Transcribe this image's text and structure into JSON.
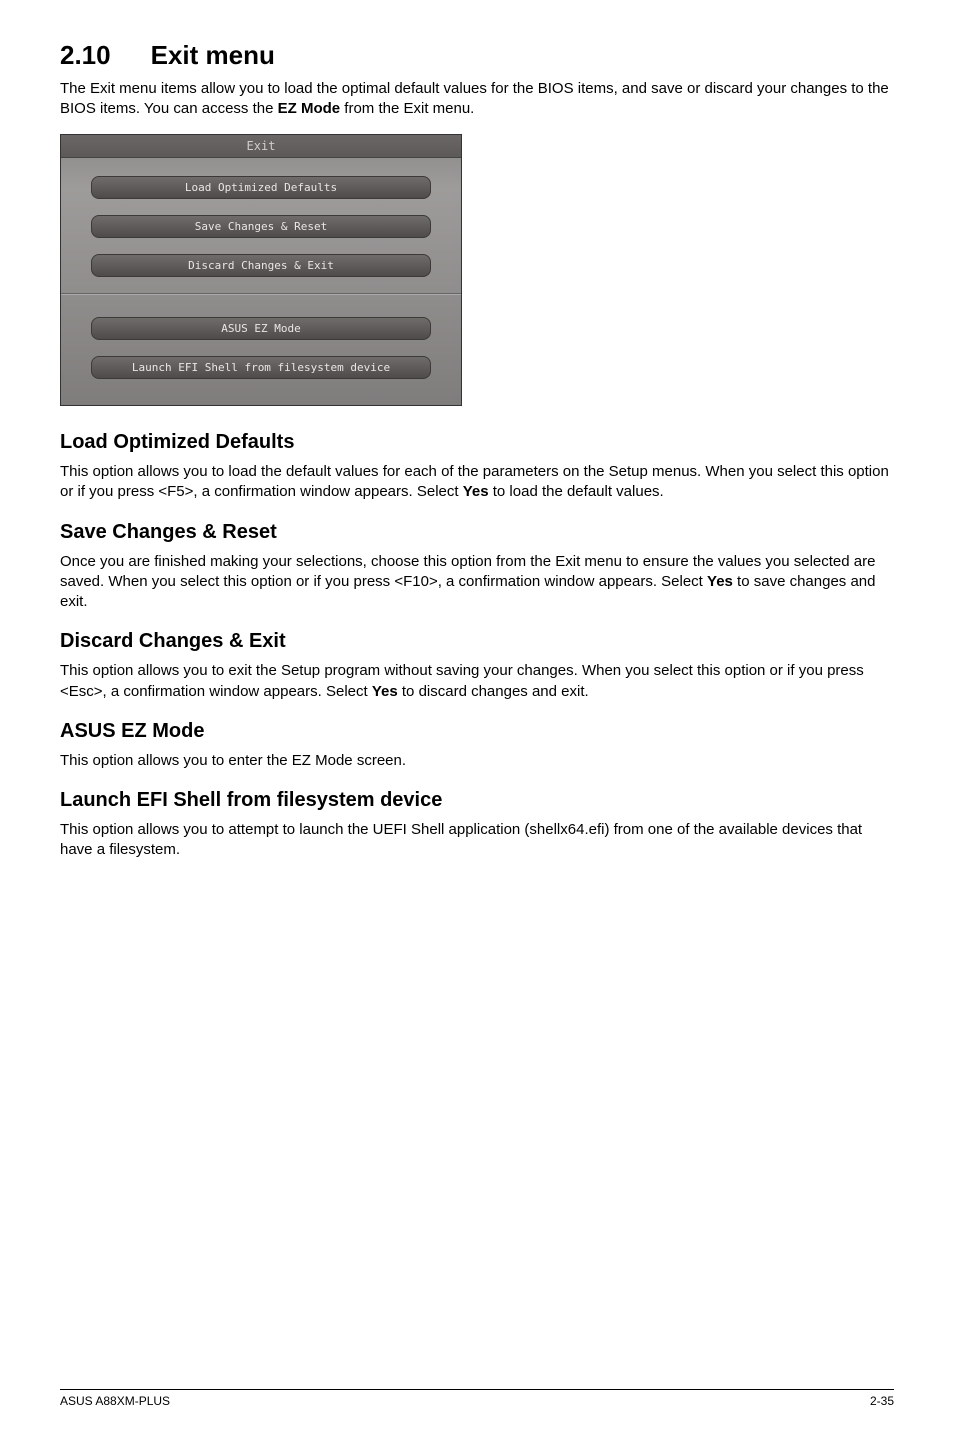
{
  "section": {
    "number": "2.10",
    "title": "Exit menu",
    "intro_pre": "The Exit menu items allow you to load the optimal default values for the BIOS items, and save or discard your changes to the BIOS items. You can access the ",
    "intro_bold": "EZ Mode",
    "intro_post": " from the Exit menu."
  },
  "bios": {
    "title": "Exit",
    "buttons_top": [
      "Load Optimized Defaults",
      "Save Changes & Reset",
      "Discard Changes & Exit"
    ],
    "buttons_bottom": [
      "ASUS EZ Mode",
      "Launch EFI Shell from filesystem device"
    ]
  },
  "subsections": {
    "load_defaults": {
      "heading": "Load Optimized Defaults",
      "p1": "This option allows you to load the default values for each of the parameters on the Setup menus. When you select this option or if you press <F5>, a confirmation window appears. Select ",
      "p1_bold": "Yes",
      "p1_tail": " to load the default values."
    },
    "save_reset": {
      "heading": "Save Changes & Reset",
      "p1": "Once you are finished making your selections, choose this option from the Exit menu to ensure the values you selected are saved. When you select this option or if you press <F10>, a confirmation window appears. Select ",
      "p1_bold": "Yes",
      "p1_tail": " to save changes and exit."
    },
    "discard_exit": {
      "heading": "Discard Changes & Exit",
      "p1": "This option allows you to exit the Setup program without saving your changes. When you select this option or if you press <Esc>, a confirmation window appears. Select ",
      "p1_bold": "Yes",
      "p1_tail": " to discard changes and exit."
    },
    "ez_mode": {
      "heading": "ASUS EZ Mode",
      "p1": "This option allows you to enter the EZ Mode screen."
    },
    "efi_shell": {
      "heading": "Launch EFI Shell from filesystem device",
      "p1": "This option allows you to attempt to launch the UEFI Shell application (shellx64.efi) from one of the available devices that have a filesystem."
    }
  },
  "footer": {
    "left": "ASUS A88XM-PLUS",
    "right": "2-35"
  }
}
